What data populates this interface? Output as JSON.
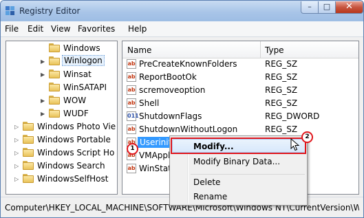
{
  "window": {
    "title": "Registry Editor",
    "controls": {
      "minimize": "–",
      "maximize": "□",
      "close": "✕"
    }
  },
  "menubar": {
    "items": [
      "File",
      "Edit",
      "View",
      "Favorites",
      "Help"
    ]
  },
  "tree": {
    "items": [
      {
        "label": "Windows",
        "expander": ""
      },
      {
        "label": "Winlogon",
        "expander": "▶",
        "selected": true
      },
      {
        "label": "Winsat",
        "expander": "▶"
      },
      {
        "label": "WinSATAPI",
        "expander": ""
      },
      {
        "label": "WOW",
        "expander": "▶"
      },
      {
        "label": "WUDF",
        "expander": "▶"
      },
      {
        "label": "Windows Photo Vie",
        "expander": "▷"
      },
      {
        "label": "Windows Portable",
        "expander": "▷"
      },
      {
        "label": "Windows Script Ho",
        "expander": "▷"
      },
      {
        "label": "Windows Search",
        "expander": "▷"
      },
      {
        "label": "WindowsSelfHost",
        "expander": "▷"
      }
    ]
  },
  "values_pane": {
    "header_name": "Name",
    "header_type": "Type",
    "rows": [
      {
        "name": "PreCreateKnownFolders",
        "type": "REG_SZ",
        "icon": "ab"
      },
      {
        "name": "ReportBootOk",
        "type": "REG_SZ",
        "icon": "ab"
      },
      {
        "name": "scremoveoption",
        "type": "REG_SZ",
        "icon": "ab"
      },
      {
        "name": "Shell",
        "type": "REG_SZ",
        "icon": "ab"
      },
      {
        "name": "ShutdownFlags",
        "type": "REG_DWORD",
        "icon": "011"
      },
      {
        "name": "ShutdownWithoutLogon",
        "type": "REG_SZ",
        "icon": "ab"
      },
      {
        "name": "Userinit",
        "type": "",
        "icon": "ab",
        "selected": true
      },
      {
        "name": "VMApplet",
        "type": "",
        "icon": "ab"
      },
      {
        "name": "WinStation",
        "type": "",
        "icon": "ab"
      }
    ]
  },
  "context_menu": {
    "items": [
      "Modify...",
      "Modify Binary Data...",
      "Delete",
      "Rename"
    ]
  },
  "annotations": {
    "step1": "1",
    "step2": "2"
  },
  "status_bar": {
    "path": "Computer\\HKEY_LOCAL_MACHINE\\SOFTWARE\\Microsoft\\Windows NT\\CurrentVersion\\W"
  },
  "colors": {
    "selection": "#3399ff",
    "callout": "#e0151b"
  }
}
